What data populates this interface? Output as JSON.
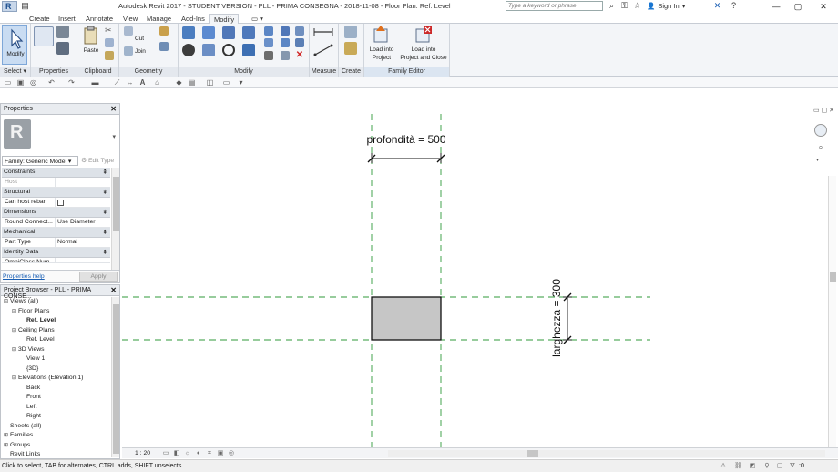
{
  "titlebar": {
    "title": "Autodesk Revit 2017 - STUDENT VERSION -    PLL - PRIMA CONSEGNA - 2018-11-08 - Floor Plan: Ref. Level",
    "app_letter": "R",
    "search_placeholder": "Type a keyword or phrase",
    "sign_in": "Sign In"
  },
  "ribbon": {
    "tabs": [
      "Create",
      "Insert",
      "Annotate",
      "View",
      "Manage",
      "Add-Ins",
      "Modify"
    ],
    "active_tab": "Modify",
    "panels": {
      "select": "Select",
      "properties": "Properties",
      "clipboard": "Clipboard",
      "geometry": "Geometry",
      "modify": "Modify",
      "measure": "Measure",
      "create": "Create",
      "family_editor": "Family Editor"
    },
    "buttons": {
      "modify": "Modify",
      "paste": "Paste",
      "cut": "Cut",
      "join": "Join",
      "load_into_project": "Load into Project",
      "load_into_project_line1": "Load into",
      "load_into_project_line2": "Project",
      "load_close_line1": "Load into",
      "load_close_line2": "Project and Close"
    }
  },
  "properties": {
    "header": "Properties",
    "preview_letter": "R",
    "family_select": "Family: Generic Model",
    "edit_type": "Edit Type",
    "categories": {
      "constraints": "Constraints",
      "structural": "Structural",
      "dimensions": "Dimensions",
      "mechanical": "Mechanical",
      "identity_data": "Identity Data"
    },
    "rows": {
      "host": {
        "name": "Host",
        "value": ""
      },
      "can_host_rebar": {
        "name": "Can host rebar",
        "value": ""
      },
      "round_connector": {
        "name": "Round Connect...",
        "value": "Use Diameter"
      },
      "part_type": {
        "name": "Part Type",
        "value": "Normal"
      },
      "omniclass": {
        "name": "OmniClass Num...",
        "value": ""
      }
    },
    "help_link": "Properties help",
    "apply_button": "Apply"
  },
  "project_browser": {
    "header": "Project Browser - PLL - PRIMA CONSE...",
    "tree": [
      {
        "label": "Views (all)",
        "toggle": "⊟",
        "indent": 0
      },
      {
        "label": "Floor Plans",
        "toggle": "⊟",
        "indent": 1
      },
      {
        "label": "Ref. Level",
        "toggle": "",
        "indent": 2,
        "selected": true
      },
      {
        "label": "Ceiling Plans",
        "toggle": "⊟",
        "indent": 1
      },
      {
        "label": "Ref. Level",
        "toggle": "",
        "indent": 2
      },
      {
        "label": "3D Views",
        "toggle": "⊟",
        "indent": 1
      },
      {
        "label": "View 1",
        "toggle": "",
        "indent": 2
      },
      {
        "label": "{3D}",
        "toggle": "",
        "indent": 2
      },
      {
        "label": "Elevations (Elevation 1)",
        "toggle": "⊟",
        "indent": 1
      },
      {
        "label": "Back",
        "toggle": "",
        "indent": 2
      },
      {
        "label": "Front",
        "toggle": "",
        "indent": 2
      },
      {
        "label": "Left",
        "toggle": "",
        "indent": 2
      },
      {
        "label": "Right",
        "toggle": "",
        "indent": 2
      },
      {
        "label": "Sheets (all)",
        "toggle": "",
        "indent": 0
      },
      {
        "label": "Families",
        "toggle": "⊞",
        "indent": 0
      },
      {
        "label": "Groups",
        "toggle": "⊞",
        "indent": 0
      },
      {
        "label": "Revit Links",
        "toggle": "",
        "indent": 0
      }
    ]
  },
  "canvas": {
    "dimension_depth": "profondità = 500",
    "dimension_width": "larghezza = 300",
    "reference_plane_color": "#2f9a3a",
    "fill_color": "#c6c6c6"
  },
  "view_controls": {
    "scale": "1 : 20"
  },
  "status_bar": {
    "text": "Click to select, TAB for alternates, CTRL adds, SHIFT unselects.",
    "selection_count": ":0"
  },
  "colors": {
    "ribbon_bg": "#f3f5f8",
    "accent": "#1a5fb4"
  }
}
